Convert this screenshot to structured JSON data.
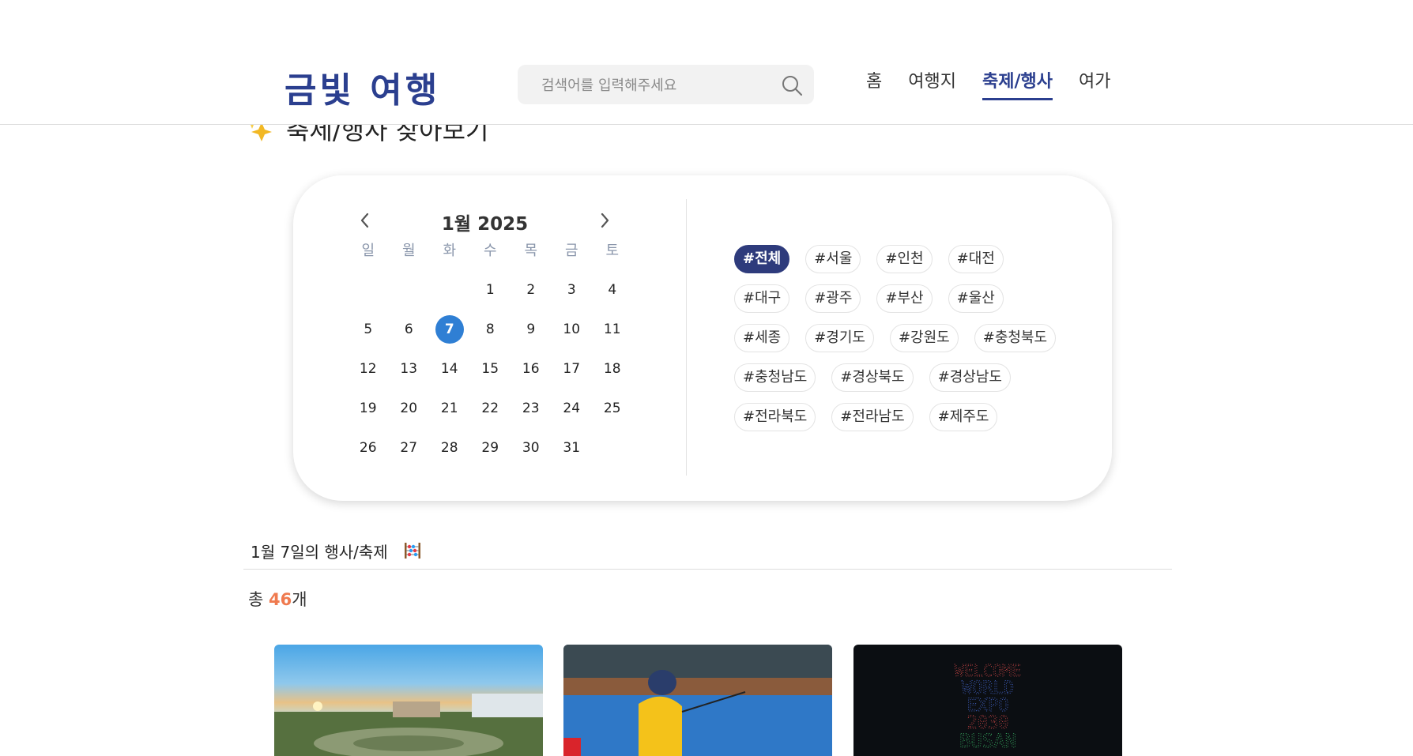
{
  "header": {
    "logo": "금빛 여행",
    "search_placeholder": "검색어를 입력해주세요",
    "nav": [
      "홈",
      "여행지",
      "축제/행사",
      "여가"
    ],
    "active_nav": "축제/행사"
  },
  "page": {
    "title": "축제/행사 찾아보기"
  },
  "calendar": {
    "title": "1월 2025",
    "weekdays": [
      "일",
      "월",
      "화",
      "수",
      "목",
      "금",
      "토"
    ],
    "days": [
      "",
      "",
      "",
      "1",
      "2",
      "3",
      "4",
      "5",
      "6",
      "7",
      "8",
      "9",
      "10",
      "11",
      "12",
      "13",
      "14",
      "15",
      "16",
      "17",
      "18",
      "19",
      "20",
      "21",
      "22",
      "23",
      "24",
      "25",
      "26",
      "27",
      "28",
      "29",
      "30",
      "31"
    ],
    "selected": "7"
  },
  "tags": [
    [
      "#전체",
      "#서울",
      "#인천",
      "#대전"
    ],
    [
      "#대구",
      "#광주",
      "#부산",
      "#울산"
    ],
    [
      "#세종",
      "#경기도",
      "#강원도",
      "#충청북도"
    ],
    [
      "#충청남도",
      "#경상북도",
      "#경상남도"
    ],
    [
      "#전라북도",
      "#전라남도",
      "#제주도"
    ]
  ],
  "active_tag": "#전체",
  "result": {
    "title": "1월 7일의 행사/축제",
    "count_prefix": "총 ",
    "count": "46",
    "count_suffix": "개"
  },
  "cards": [
    {
      "image": "garden-sunset-photo"
    },
    {
      "image": "ice-fishing-photo"
    },
    {
      "image": "drone-show-photo",
      "drone_text": [
        "WELCOME",
        "WORLD",
        "EXPO",
        "2030",
        "BUSAN"
      ]
    }
  ],
  "colors": {
    "brand": "#2b3f8f",
    "accent": "#2f7fd4",
    "count": "#ef7a4f",
    "tag_active": "#2e3b7c"
  }
}
